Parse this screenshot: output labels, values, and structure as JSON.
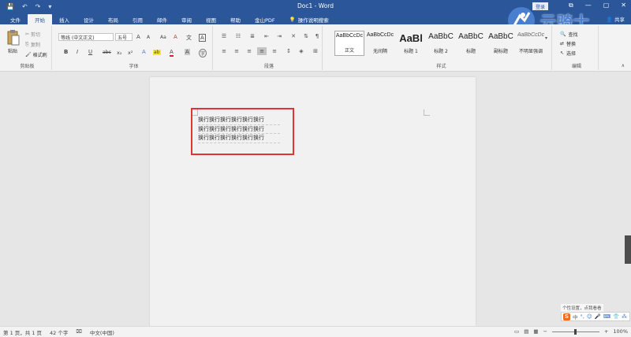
{
  "title_bar": {
    "doc_title": "Doc1 - Word",
    "login_label": "登录",
    "qat": {
      "save": "💾",
      "undo": "↶",
      "redo": "↷",
      "more": "▾"
    },
    "window_controls": {
      "ribbon_display": "⧉",
      "minimize": "—",
      "restore": "▢",
      "close": "✕"
    }
  },
  "watermark_text": "云骑士",
  "tabs": [
    {
      "label": "文件"
    },
    {
      "label": "开始"
    },
    {
      "label": "插入"
    },
    {
      "label": "设计"
    },
    {
      "label": "布局"
    },
    {
      "label": "引用"
    },
    {
      "label": "邮件"
    },
    {
      "label": "审阅"
    },
    {
      "label": "视图"
    },
    {
      "label": "帮助"
    },
    {
      "label": "金山PDF"
    },
    {
      "label": "操作说明搜索"
    }
  ],
  "active_tab": "开始",
  "share_label": "共享",
  "ribbon": {
    "clipboard": {
      "label": "剪贴板",
      "paste": "粘贴",
      "cut": "剪切",
      "copy": "复制",
      "format_painter": "格式刷"
    },
    "font": {
      "label": "字体",
      "font_name": "等线 (中文正文)",
      "font_size": "五号",
      "grow": "A",
      "shrink": "A",
      "change_case": "Aa",
      "clear_format": "A",
      "phonetic": "文",
      "border_char": "A",
      "bold": "B",
      "italic": "I",
      "underline": "U",
      "strike": "abc",
      "subscript": "x₂",
      "superscript": "x²",
      "text_effect": "A",
      "highlight": "ab",
      "font_color": "A",
      "char_shading": "A",
      "enclose": "字"
    },
    "paragraph": {
      "label": "段落"
    },
    "styles": {
      "label": "样式",
      "items": [
        {
          "sample": "AaBbCcDc",
          "name": "正文"
        },
        {
          "sample": "AaBbCcDc",
          "name": "无间隔"
        },
        {
          "sample": "AaBl",
          "name": "标题 1"
        },
        {
          "sample": "AaBbC",
          "name": "标题 2"
        },
        {
          "sample": "AaBbC",
          "name": "标题"
        },
        {
          "sample": "AaBbC",
          "name": "副标题"
        },
        {
          "sample": "AaBbCcDc",
          "name": "不明显强调"
        }
      ]
    },
    "editing": {
      "label": "编辑",
      "find": "查找",
      "replace": "替换",
      "select": "选择"
    }
  },
  "document": {
    "lines": [
      "换行换行换行换行换行换行",
      "换行换行换行换行换行换行",
      "换行换行换行换行换行换行"
    ]
  },
  "ime": {
    "tip": "个性设置，点我看看",
    "logo": "S",
    "mode": "中",
    "punct": "°,",
    "emoji": "☺",
    "voice": "🎤",
    "keyboard": "⌨",
    "skin": "👕",
    "tools": "⁂"
  },
  "status": {
    "page": "第 1 页，共 1 页",
    "words": "42 个字",
    "language": "中文(中国)",
    "zoom_minus": "−",
    "zoom_plus": "+",
    "zoom": "100%",
    "zoom_level_fraction": 0.5
  }
}
